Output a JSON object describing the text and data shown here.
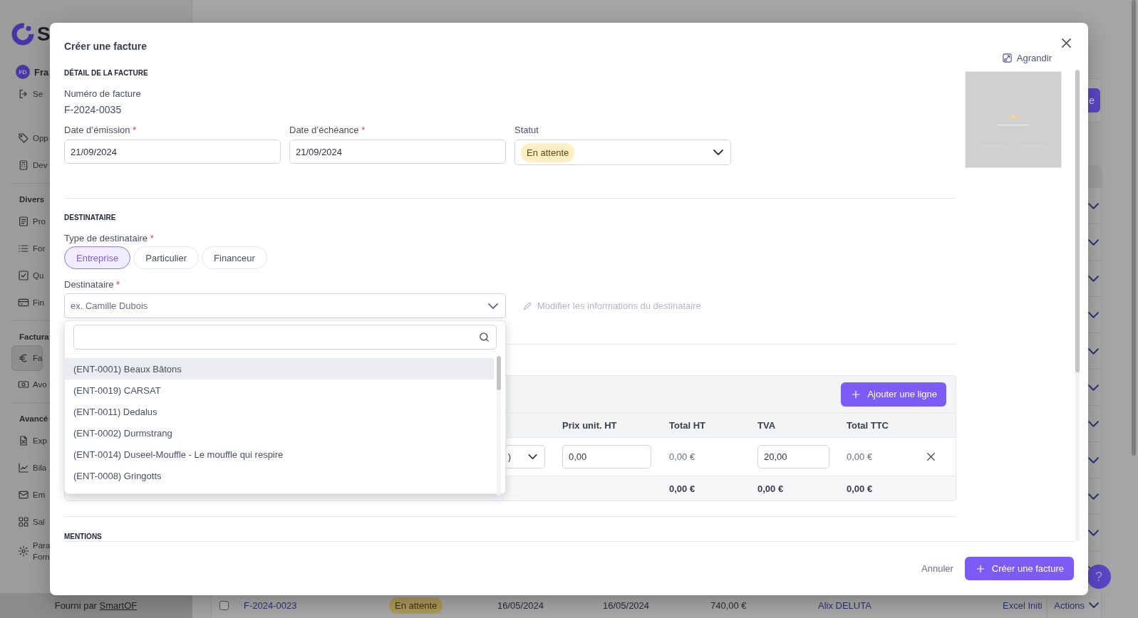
{
  "sidebar": {
    "logo_text": "S",
    "user": {
      "initials": "FD",
      "name": "Fra"
    },
    "sections": [
      {
        "items": [
          {
            "label": "Se",
            "selected": false
          }
        ]
      },
      {
        "items": [
          {
            "label": "Opp",
            "selected": false
          },
          {
            "label": "Dev",
            "selected": false
          }
        ]
      },
      {
        "title": "Divers",
        "items": [
          {
            "label": "Pro",
            "selected": false
          },
          {
            "label": "For",
            "selected": false
          },
          {
            "label": "Qu",
            "selected": false
          },
          {
            "label": "Fin",
            "selected": false
          }
        ]
      },
      {
        "title": "Factura",
        "items": [
          {
            "label": "Fa",
            "selected": true
          },
          {
            "label": "Avo",
            "selected": false
          }
        ]
      },
      {
        "title": "Avancé",
        "items": [
          {
            "label": "Exp",
            "selected": false
          },
          {
            "label": "Bila",
            "selected": false
          },
          {
            "label": "Em",
            "selected": false
          },
          {
            "label": "Sal",
            "selected": false
          },
          {
            "label": "Para\nForn",
            "selected": false
          }
        ]
      }
    ],
    "footer": {
      "text": "Fourni par ",
      "link": "SmartOF"
    }
  },
  "main": {
    "header_button": "e",
    "last_row": {
      "checked": false,
      "number": "F-2024-0023",
      "status": "En attente",
      "issue_date": "16/05/2024",
      "due_date": "16/05/2024",
      "amount": "740,00 €",
      "client": "Alix DELUTA",
      "training": "Excel Initi",
      "actions": "Actions"
    },
    "help_button": "?"
  },
  "modal": {
    "title": "Créer une facture",
    "expand_link": "Agrandir",
    "details": {
      "heading": "DÉTAIL DE LA FACTURE",
      "number_label": "Numéro de facture",
      "number": "F-2024-0035",
      "fields": [
        {
          "kind": "date",
          "label": "Date d’émission",
          "required_mark": "*",
          "value": "21/09/2024"
        },
        {
          "kind": "date",
          "label": "Date d’échéance",
          "required_mark": "*",
          "value": "21/09/2024"
        },
        {
          "kind": "select",
          "label": "Statut",
          "value": "En attente"
        }
      ]
    },
    "recipient": {
      "heading": "DESTINATAIRE",
      "type_label": "Type de destinataire",
      "type_required_mark": "*",
      "types": [
        {
          "label": "Entreprise",
          "selected": true
        },
        {
          "label": "Particulier",
          "selected": false
        },
        {
          "label": "Financeur",
          "selected": false
        }
      ],
      "recipient_label": "Destinataire",
      "recipient_required_mark": "*",
      "placeholder": "ex. Camille Dubois",
      "edit_link": {
        "label": "Modifier les informations du destinataire",
        "disabled": true
      },
      "options": [
        {
          "label": "(ENT-0001) Beaux Bâtons",
          "highlighted": true
        },
        {
          "label": "(ENT-0019) CARSAT",
          "highlighted": false
        },
        {
          "label": "(ENT-0011) Dedalus",
          "highlighted": false
        },
        {
          "label": "(ENT-0002) Durmstrang",
          "highlighted": false
        },
        {
          "label": "(ENT-0014) Duseel-Mouffle - Le mouffle qui respire",
          "highlighted": false
        },
        {
          "label": "(ENT-0008) Gringotts",
          "highlighted": false
        }
      ]
    },
    "lines": {
      "add_button": "Ajouter une ligne",
      "columns": [
        "Prix unit. HT",
        "Total HT",
        "TVA",
        "Total TTC"
      ],
      "rows": [
        {
          "product": ")",
          "unit_price": "0,00",
          "total_ht": "0,00 €",
          "vat": "20,00",
          "total_ttc": "0,00 €"
        }
      ],
      "totals": [
        "0,00 €",
        "0,00 €",
        "0,00 €"
      ]
    },
    "mentions_heading": "MENTIONS",
    "cancel": "Annuler",
    "submit": "Créer une facture"
  }
}
